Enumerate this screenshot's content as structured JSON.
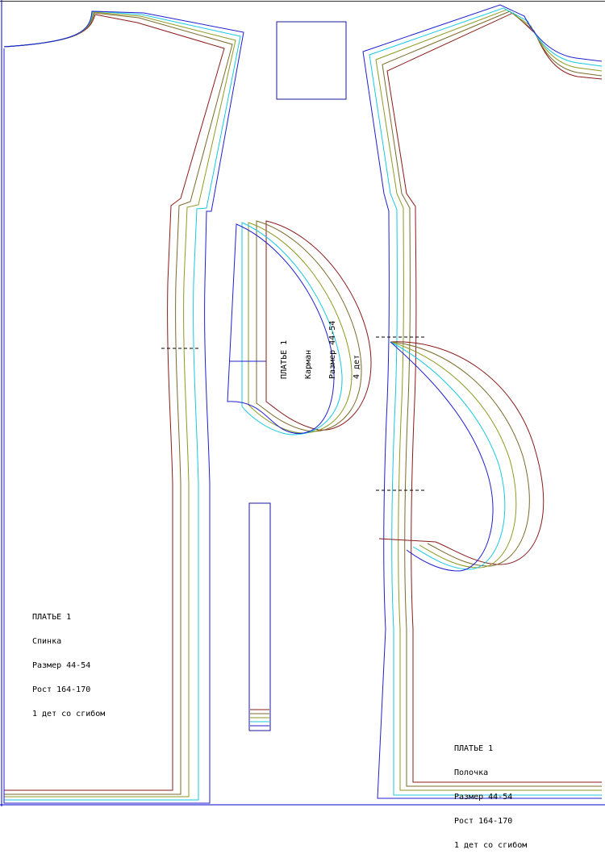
{
  "colors": {
    "size_44": "#1f1fd0",
    "size_46": "#19c8e0",
    "size_48": "#8e9a22",
    "size_50": "#7a6a2a",
    "size_52": "#8b1a1a",
    "frame": "#1a1a9a",
    "border": "#0000cc"
  },
  "back_piece": {
    "line1": "ПЛАТЬЕ 1",
    "line2": "Спинка",
    "line3": "Размер 44-54",
    "line4": "Рост 164-170",
    "line5": "1 дет со сгибом"
  },
  "front_piece": {
    "line1": "ПЛАТЬЕ 1",
    "line2": "Полочка",
    "line3": "Размер 44-54",
    "line4": "Рост 164-170",
    "line5": "1 дет со сгибом"
  },
  "pocket_piece": {
    "line1": "ПЛАТЬЕ 1",
    "line2": "Карман",
    "line3": "Размер 44-54",
    "line4": "4 дет"
  }
}
